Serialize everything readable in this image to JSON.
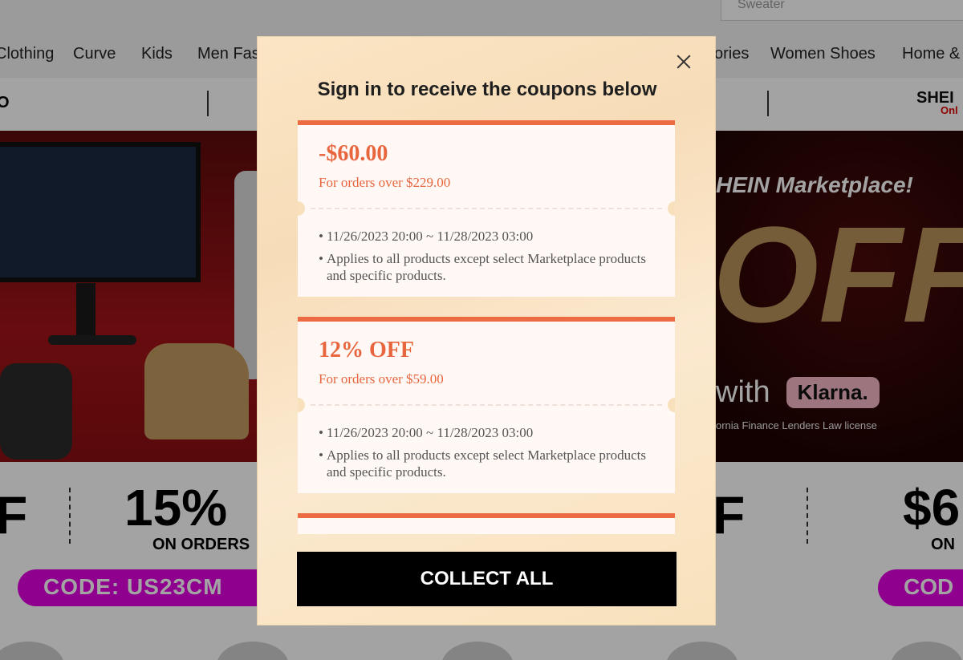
{
  "background": {
    "search_value": "Sweater",
    "nav_items": [
      "Clothing",
      "Curve",
      "Kids",
      "Men Fas",
      "ories",
      "Women Shoes",
      "Home &"
    ],
    "promo_left": "O",
    "brand_name": "SHEI",
    "brand_sub": "Onl",
    "banner": {
      "marketplace_title": "HEIN Marketplace!",
      "big_text": "OFF",
      "with_text": "with",
      "klarna": "Klarna.",
      "license": "ornia Finance Lenders Law license"
    },
    "deals": {
      "left_fragment": "F",
      "percent": "15%",
      "on_orders": "ON ORDERS",
      "code": "CODE: US23CM",
      "mid_fragment": "F",
      "right_amount": "$6",
      "right_on": "ON",
      "right_code": "COD"
    }
  },
  "modal": {
    "title": "Sign in to receive the coupons below",
    "close_label": "×",
    "coupons": [
      {
        "amount": "-$60.00",
        "condition": "For orders over $229.00",
        "bullets": [
          "11/26/2023 20:00 ~ 11/28/2023 03:00",
          "Applies to all products except select Marketplace products and specific products."
        ]
      },
      {
        "amount": "12% OFF",
        "condition": "For orders over $59.00",
        "bullets": [
          "11/26/2023 20:00 ~ 11/28/2023 03:00",
          "Applies to all products except select Marketplace products and specific products."
        ]
      }
    ],
    "collect_label": "COLLECT ALL"
  },
  "colors": {
    "accent": "#ec6b43",
    "button": "#000000",
    "modal_bg": "#fbe5c4"
  }
}
